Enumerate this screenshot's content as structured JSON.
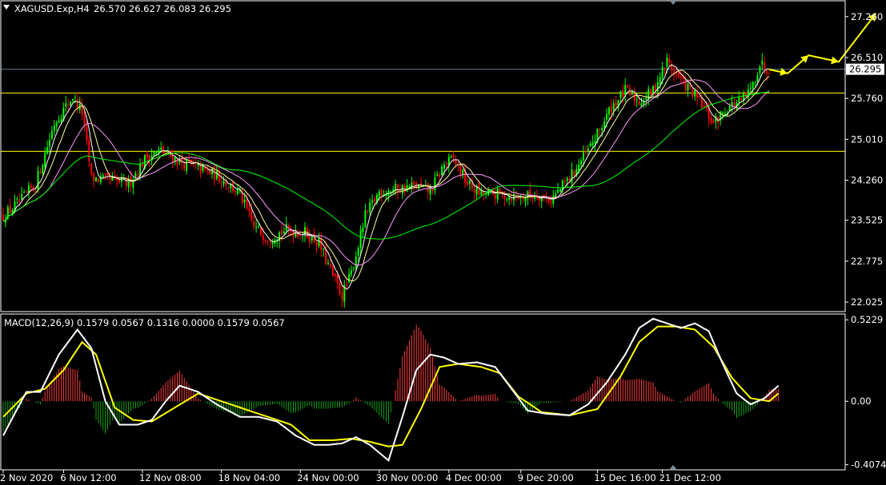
{
  "header": {
    "symbol_label": "XAGUSD.Exp,H4",
    "ohlc_values": "26.570 26.627 26.083 26.295",
    "macd_label": "MACD(12,26,9) 0.1579 0.0567 0.1316 0.0000 0.1579 0.0567"
  },
  "colors": {
    "background": "#000000",
    "frame": "#ffffff",
    "bull_candle": "#00ff00",
    "bear_candle": "#ff0000",
    "ma_fast": "#ffffff",
    "ma_mid": "#ffff99",
    "ma_slow": "#ff99ff",
    "ma_long": "#00ff00",
    "level_line": "#ffff00",
    "price_line": "#5f7a8f",
    "arrow": "#ffff00",
    "macd_line": "#ffffff",
    "signal_line": "#ffff00",
    "hist_pos": "#ff3b3b",
    "hist_neg": "#16a516"
  },
  "chart_data": [
    {
      "type": "candlestick",
      "symbol": "XAGUSD.Exp",
      "timeframe": "H4",
      "ylim": [
        21.85,
        27.55
      ],
      "y_ticks": [
        "27.260",
        "26.510",
        "25.760",
        "25.010",
        "24.260",
        "23.525",
        "22.775",
        "22.025"
      ],
      "y_tick_values": [
        27.26,
        26.51,
        25.76,
        25.01,
        24.26,
        23.525,
        22.775,
        22.025
      ],
      "current_price": "26.295",
      "current_price_value": 26.295,
      "horizontal_levels": [
        25.86,
        24.79
      ],
      "x_ticks": [
        "2 Nov 2020",
        "6 Nov 12:00",
        "12 Nov 08:00",
        "18 Nov 04:00",
        "24 Nov 00:00",
        "30 Nov 00:00",
        "4 Dec 00:00",
        "9 Dec 20:00",
        "15 Dec 16:00",
        "21 Dec 12:00"
      ],
      "x_tick_index": [
        0,
        26,
        60,
        94,
        128,
        162,
        192,
        223,
        256,
        284
      ],
      "bar_count": 340,
      "close_anchors": [
        [
          0,
          23.6
        ],
        [
          8,
          23.9
        ],
        [
          14,
          24.2
        ],
        [
          22,
          25.3
        ],
        [
          30,
          25.8
        ],
        [
          34,
          25.5
        ],
        [
          38,
          24.3
        ],
        [
          46,
          24.25
        ],
        [
          54,
          24.2
        ],
        [
          62,
          24.7
        ],
        [
          68,
          24.8
        ],
        [
          76,
          24.6
        ],
        [
          86,
          24.45
        ],
        [
          94,
          24.3
        ],
        [
          102,
          24.0
        ],
        [
          108,
          23.4
        ],
        [
          114,
          23.2
        ],
        [
          122,
          23.35
        ],
        [
          130,
          23.3
        ],
        [
          136,
          23.1
        ],
        [
          142,
          22.5
        ],
        [
          146,
          22.15
        ],
        [
          150,
          22.55
        ],
        [
          156,
          23.6
        ],
        [
          162,
          24.05
        ],
        [
          170,
          24.1
        ],
        [
          178,
          24.15
        ],
        [
          184,
          24.05
        ],
        [
          190,
          24.55
        ],
        [
          194,
          24.65
        ],
        [
          200,
          24.2
        ],
        [
          206,
          24.0
        ],
        [
          214,
          24.0
        ],
        [
          222,
          23.95
        ],
        [
          230,
          24.0
        ],
        [
          236,
          23.9
        ],
        [
          244,
          24.3
        ],
        [
          252,
          24.8
        ],
        [
          256,
          25.1
        ],
        [
          262,
          25.6
        ],
        [
          268,
          25.9
        ],
        [
          274,
          25.7
        ],
        [
          280,
          25.9
        ],
        [
          286,
          26.45
        ],
        [
          290,
          26.2
        ],
        [
          296,
          25.9
        ],
        [
          300,
          25.7
        ],
        [
          306,
          25.3
        ],
        [
          312,
          25.6
        ],
        [
          318,
          25.7
        ],
        [
          322,
          25.9
        ],
        [
          326,
          26.4
        ],
        [
          330,
          26.29
        ]
      ],
      "forecast_path": [
        [
          330,
          26.29
        ],
        [
          338,
          26.22
        ],
        [
          347,
          26.55
        ],
        [
          360,
          26.43
        ],
        [
          376,
          27.32
        ]
      ]
    },
    {
      "type": "macd",
      "params": "12,26,9",
      "ylim": [
        -0.44,
        0.56
      ],
      "y_ticks": [
        "0.5229",
        "0.00",
        "-0.4074"
      ],
      "y_tick_values": [
        0.5229,
        0.0,
        -0.4074
      ],
      "macd_anchors": [
        [
          0,
          -0.22
        ],
        [
          6,
          -0.05
        ],
        [
          10,
          0.06
        ],
        [
          16,
          0.06
        ],
        [
          24,
          0.3
        ],
        [
          32,
          0.46
        ],
        [
          38,
          0.34
        ],
        [
          44,
          0.0
        ],
        [
          50,
          -0.15
        ],
        [
          58,
          -0.15
        ],
        [
          64,
          -0.12
        ],
        [
          70,
          0.0
        ],
        [
          76,
          0.1
        ],
        [
          84,
          0.06
        ],
        [
          92,
          -0.02
        ],
        [
          102,
          -0.1
        ],
        [
          110,
          -0.1
        ],
        [
          118,
          -0.13
        ],
        [
          126,
          -0.22
        ],
        [
          134,
          -0.28
        ],
        [
          140,
          -0.28
        ],
        [
          146,
          -0.27
        ],
        [
          152,
          -0.23
        ],
        [
          158,
          -0.28
        ],
        [
          166,
          -0.38
        ],
        [
          172,
          -0.1
        ],
        [
          178,
          0.2
        ],
        [
          184,
          0.3
        ],
        [
          190,
          0.28
        ],
        [
          196,
          0.24
        ],
        [
          204,
          0.25
        ],
        [
          212,
          0.22
        ],
        [
          220,
          0.06
        ],
        [
          226,
          -0.06
        ],
        [
          234,
          -0.08
        ],
        [
          244,
          -0.09
        ],
        [
          252,
          -0.02
        ],
        [
          260,
          0.12
        ],
        [
          268,
          0.3
        ],
        [
          274,
          0.47
        ],
        [
          280,
          0.53
        ],
        [
          286,
          0.5
        ],
        [
          292,
          0.47
        ],
        [
          298,
          0.5
        ],
        [
          304,
          0.45
        ],
        [
          310,
          0.24
        ],
        [
          316,
          0.05
        ],
        [
          322,
          -0.02
        ],
        [
          328,
          0.02
        ],
        [
          334,
          0.1
        ]
      ],
      "signal_anchors": [
        [
          0,
          -0.1
        ],
        [
          10,
          0.05
        ],
        [
          18,
          0.08
        ],
        [
          26,
          0.2
        ],
        [
          34,
          0.38
        ],
        [
          40,
          0.3
        ],
        [
          48,
          -0.04
        ],
        [
          56,
          -0.12
        ],
        [
          64,
          -0.13
        ],
        [
          74,
          -0.04
        ],
        [
          84,
          0.05
        ],
        [
          94,
          0.0
        ],
        [
          104,
          -0.05
        ],
        [
          112,
          -0.09
        ],
        [
          124,
          -0.15
        ],
        [
          132,
          -0.25
        ],
        [
          142,
          -0.25
        ],
        [
          150,
          -0.24
        ],
        [
          158,
          -0.26
        ],
        [
          166,
          -0.29
        ],
        [
          172,
          -0.28
        ],
        [
          180,
          -0.05
        ],
        [
          188,
          0.22
        ],
        [
          196,
          0.24
        ],
        [
          206,
          0.22
        ],
        [
          214,
          0.18
        ],
        [
          222,
          0.03
        ],
        [
          232,
          -0.07
        ],
        [
          244,
          -0.09
        ],
        [
          256,
          -0.05
        ],
        [
          266,
          0.16
        ],
        [
          274,
          0.38
        ],
        [
          282,
          0.48
        ],
        [
          290,
          0.48
        ],
        [
          298,
          0.46
        ],
        [
          306,
          0.35
        ],
        [
          314,
          0.15
        ],
        [
          322,
          0.02
        ],
        [
          330,
          0.0
        ],
        [
          334,
          0.05
        ]
      ]
    }
  ]
}
